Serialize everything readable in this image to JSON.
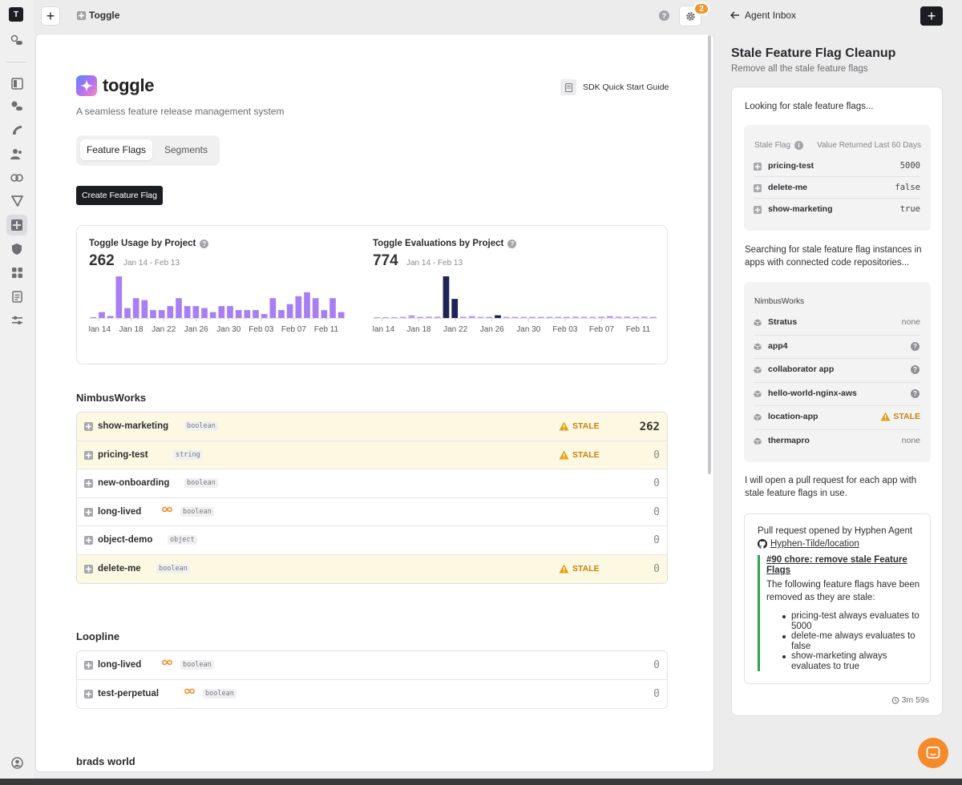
{
  "rail": {
    "logo": "T"
  },
  "topbar": {
    "breadcrumb": "Toggle",
    "notifications": "2"
  },
  "brand": {
    "name": "toggle",
    "tagline": "A seamless feature release management system",
    "sdk_link": "SDK Quick Start Guide"
  },
  "tabs": [
    {
      "label": "Feature Flags",
      "active": true
    },
    {
      "label": "Segments",
      "active": false
    }
  ],
  "create_button": "Create Feature Flag",
  "chart_data": [
    {
      "type": "bar",
      "title": "Toggle Usage by Project",
      "total": "262",
      "range": "Jan 14 - Feb 13",
      "tick_labels": [
        "Jan 14",
        "Jan 18",
        "Jan 22",
        "Jan 26",
        "Jan 30",
        "Feb 03",
        "Feb 07",
        "Feb 11"
      ],
      "values": [
        0,
        3,
        1,
        21,
        5,
        10,
        9,
        4,
        4,
        6,
        10,
        6,
        6,
        5,
        3,
        6,
        6,
        4,
        4,
        4,
        2,
        10,
        4,
        7,
        11,
        13,
        10,
        4,
        10,
        3
      ],
      "color": "#a87ff3"
    },
    {
      "type": "bar",
      "title": "Toggle Evaluations by Project",
      "total": "774",
      "range": "Jan 14 - Feb 13",
      "tick_labels": [
        "Jan 14",
        "Jan 18",
        "Jan 22",
        "Jan 26",
        "Jan 30",
        "Feb 03",
        "Feb 07",
        "Feb 11"
      ],
      "values": [
        0,
        0,
        0,
        1,
        4,
        1,
        2,
        2,
        61,
        28,
        2,
        3,
        1,
        1,
        4,
        1,
        1,
        1,
        1,
        1,
        1,
        1,
        1,
        2,
        1,
        1,
        2,
        3,
        2,
        2,
        1,
        2,
        1
      ],
      "highlight": [
        8,
        9,
        14
      ],
      "color": "#b89ff0",
      "highlight_color": "#1f2457"
    }
  ],
  "projects": [
    {
      "name": "NimbusWorks",
      "flags": [
        {
          "name": "show-marketing",
          "type": "boolean",
          "stale": true,
          "permanent": false,
          "count": "262"
        },
        {
          "name": "pricing-test",
          "type": "string",
          "stale": true,
          "permanent": false,
          "count": "0"
        },
        {
          "name": "new-onboarding",
          "type": "boolean",
          "stale": false,
          "permanent": false,
          "count": "0"
        },
        {
          "name": "long-lived",
          "type": "boolean",
          "stale": false,
          "permanent": true,
          "count": "0"
        },
        {
          "name": "object-demo",
          "type": "object",
          "stale": false,
          "permanent": false,
          "count": "0"
        },
        {
          "name": "delete-me",
          "type": "boolean",
          "stale": true,
          "permanent": false,
          "count": "0"
        }
      ]
    },
    {
      "name": "Loopline",
      "flags": [
        {
          "name": "long-lived",
          "type": "boolean",
          "stale": false,
          "permanent": true,
          "count": "0"
        },
        {
          "name": "test-perpetual",
          "type": "boolean",
          "stale": false,
          "permanent": true,
          "count": "0"
        }
      ]
    },
    {
      "name": "brads world",
      "flags": []
    }
  ],
  "stale_label": "STALE",
  "agent": {
    "inbox_label": "Agent Inbox",
    "title": "Stale Feature Flag Cleanup",
    "subtitle": "Remove all the stale feature flags",
    "msg1": "Looking for stale feature flags...",
    "table_headers": [
      "Stale Flag",
      "Value Returned Last 60 Days"
    ],
    "stale_flags": [
      {
        "name": "pricing-test",
        "value": "5000"
      },
      {
        "name": "delete-me",
        "value": "false"
      },
      {
        "name": "show-marketing",
        "value": "true"
      }
    ],
    "msg2": "Searching for stale feature flag instances in apps with connected code repositories...",
    "org": "NimbusWorks",
    "apps": [
      {
        "name": "Stratus",
        "status": "none"
      },
      {
        "name": "app4",
        "status": "?"
      },
      {
        "name": "collaborator app",
        "status": "?"
      },
      {
        "name": "hello-world-nginx-aws",
        "status": "?"
      },
      {
        "name": "location-app",
        "status": "STALE"
      },
      {
        "name": "thermapro",
        "status": "none"
      }
    ],
    "msg3": "I will open a pull request for each app with stale feature flags in use.",
    "pr": {
      "opened_by": "Pull request opened by Hyphen Agent",
      "repo": "Hyphen-Tilde/location",
      "title": "#90 chore: remove stale Feature Flags",
      "desc": "The following feature flags have been removed as they are stale:",
      "items": [
        "pricing-test always evaluates to 5000",
        "delete-me always evaluates to false",
        "show-marketing always evaluates to true"
      ]
    },
    "elapsed": "3m 59s"
  },
  "colors": {
    "accent": "#a87ff3",
    "stale": "#c9820c",
    "stale_bg": "#fdf8e1",
    "pr_bar": "#2da44e",
    "chat": "#f58a2a"
  }
}
